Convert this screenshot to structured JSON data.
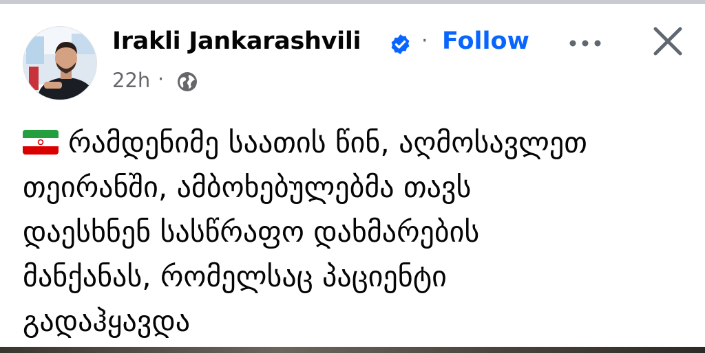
{
  "post": {
    "author": "Irakli Jankarashvili",
    "follow_label": "Follow",
    "separator": "·",
    "time": "22h",
    "meta_separator": "·",
    "flag_icon": "iran-flag-icon",
    "lines": [
      "რამდენიმე საათის წინ, აღმოსავლეთ",
      "თეირანში, ამბოხებულებმა თავს",
      "დაესხნენ სასწრაფო დახმარების",
      "მანქანას, რომელსაც პაციენტი",
      "გადაჰყავდა"
    ]
  },
  "icons": {
    "verified": "verified-badge-icon",
    "more": "more-options-icon",
    "close": "close-icon",
    "privacy": "globe-icon"
  },
  "colors": {
    "accent": "#0866ff",
    "secondary_text": "#65676b",
    "verified": "#0866ff"
  }
}
